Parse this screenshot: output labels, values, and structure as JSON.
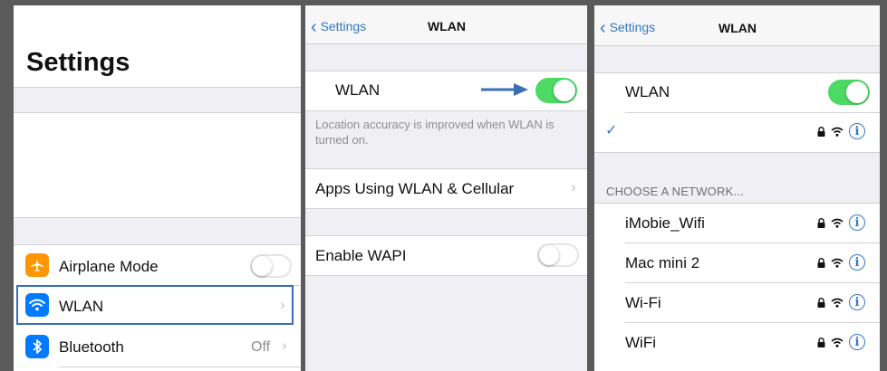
{
  "settings_panel": {
    "title": "Settings",
    "rows": [
      {
        "label": "Airplane Mode",
        "icon": "airplane-icon",
        "icon_color": "#ff9500",
        "toggle": "off"
      },
      {
        "label": "WLAN",
        "icon": "wifi-icon",
        "icon_color": "#007aff",
        "highlighted": true
      },
      {
        "label": "Bluetooth",
        "icon": "bluetooth-icon",
        "icon_color": "#007aff",
        "detail": "Off"
      }
    ],
    "highlight_color": "#3a6fb5"
  },
  "wlan_panel_1": {
    "back_label": "Settings",
    "title": "WLAN",
    "wlan_label": "WLAN",
    "wlan_toggle": "on",
    "footnote": "Location accuracy is improved when WLAN is turned on.",
    "apps_label": "Apps Using WLAN & Cellular",
    "wapi_label": "Enable WAPI",
    "wapi_toggle": "off",
    "arrow_color": "#3a6fb5"
  },
  "wlan_panel_2": {
    "back_label": "Settings",
    "title": "WLAN",
    "wlan_label": "WLAN",
    "wlan_toggle": "on",
    "connected_network": "",
    "section_header": "CHOOSE A NETWORK...",
    "networks": [
      "iMobie_Wifi",
      "Mac mini 2",
      "Wi-Fi",
      "WiFi"
    ]
  },
  "colors": {
    "accent": "#3478c8",
    "toggle_on": "#4cd964",
    "background": "#efeff4"
  }
}
